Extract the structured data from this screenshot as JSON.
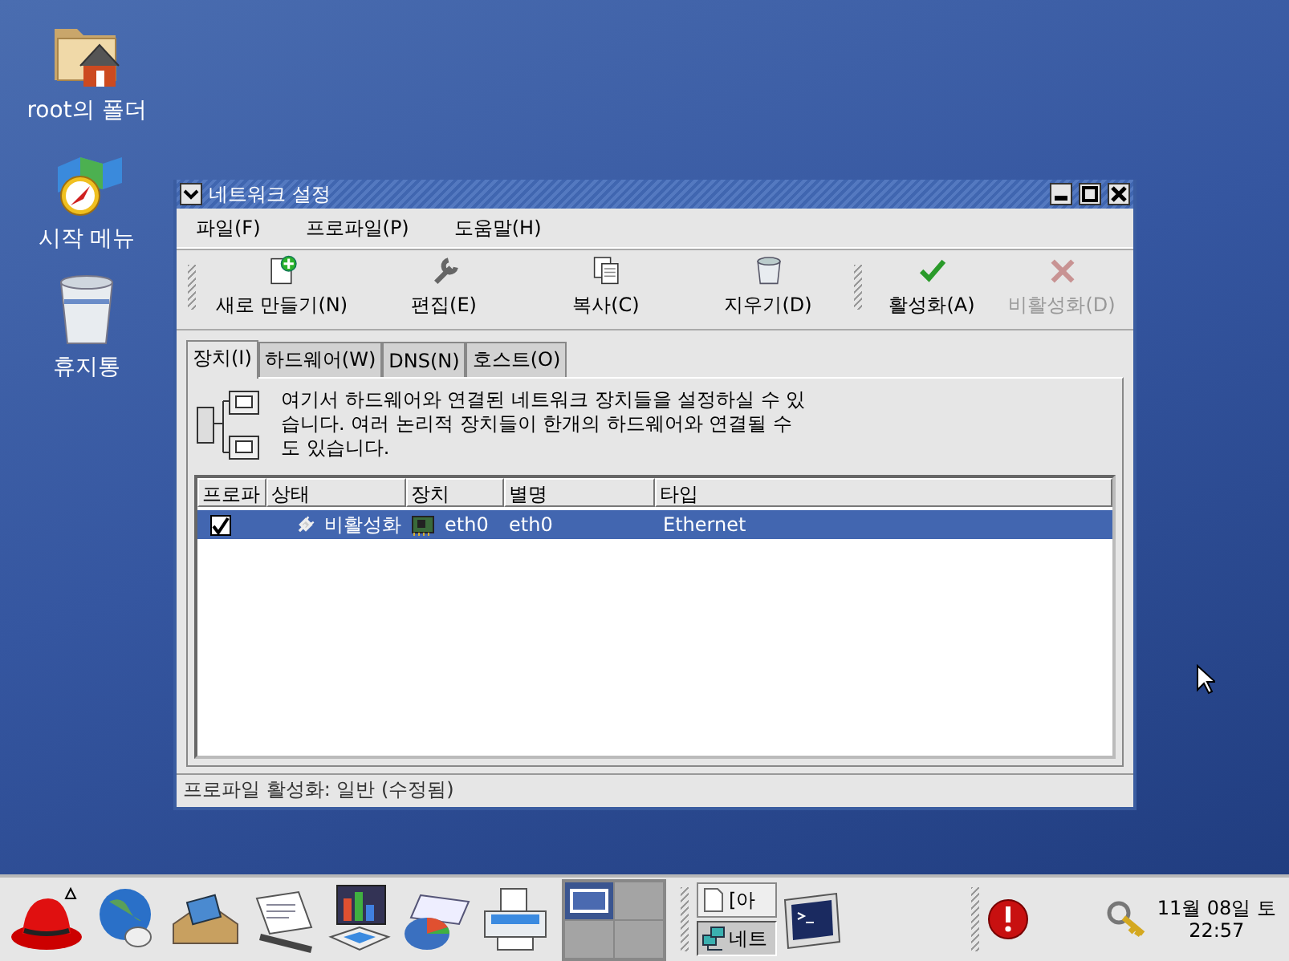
{
  "desktop_icons": [
    {
      "label": "root의 폴더",
      "kind": "folder"
    },
    {
      "label": "시작 메뉴",
      "kind": "start"
    },
    {
      "label": "휴지통",
      "kind": "trash"
    }
  ],
  "window": {
    "title": "네트워크 설정",
    "menu": [
      "파일(F)",
      "프로파일(P)",
      "도움말(H)"
    ],
    "toolbar": [
      [
        {
          "label": "새로 만들기(N)",
          "kind": "new",
          "disabled": false
        },
        {
          "label": "편집(E)",
          "kind": "edit",
          "disabled": false
        },
        {
          "label": "복사(C)",
          "kind": "copy",
          "disabled": false
        },
        {
          "label": "지우기(D)",
          "kind": "delete",
          "disabled": false
        }
      ],
      [
        {
          "label": "활성화(A)",
          "kind": "activate",
          "disabled": false
        },
        {
          "label": "비활성화(D)",
          "kind": "deactivate",
          "disabled": true
        }
      ]
    ],
    "tabs": [
      {
        "label": "장치(I)",
        "selected": true
      },
      {
        "label": "하드웨어(W)",
        "selected": false
      },
      {
        "label": "DNS(N)",
        "selected": false
      },
      {
        "label": "호스트(O)",
        "selected": false
      }
    ],
    "description": "여기서 하드웨어와 연결된 네트워크 장치들을 설정하실 수 있습니다.  여러 논리적 장치들이 한개의 하드웨어와 연결될 수도 있습니다.",
    "table": {
      "columns": [
        "프로파",
        "상태",
        "장치",
        "별명",
        "타입"
      ],
      "rows": [
        {
          "selected": true,
          "checked": true,
          "status": "비활성화",
          "device": "eth0",
          "alias": "eth0",
          "type": "Ethernet"
        }
      ]
    },
    "status_bar": "프로파일 활성화: 일반 (수정됨)"
  },
  "panel": {
    "workspaces": [
      {
        "selected": true
      },
      {
        "selected": false
      },
      {
        "selected": false
      },
      {
        "selected": false
      }
    ],
    "tasks": [
      {
        "label": "[아",
        "kind": "file",
        "selected": false
      },
      {
        "label": "네트",
        "kind": "network",
        "selected": true
      }
    ],
    "clock": {
      "date": "11월 08일 토",
      "time": "22:57"
    }
  }
}
